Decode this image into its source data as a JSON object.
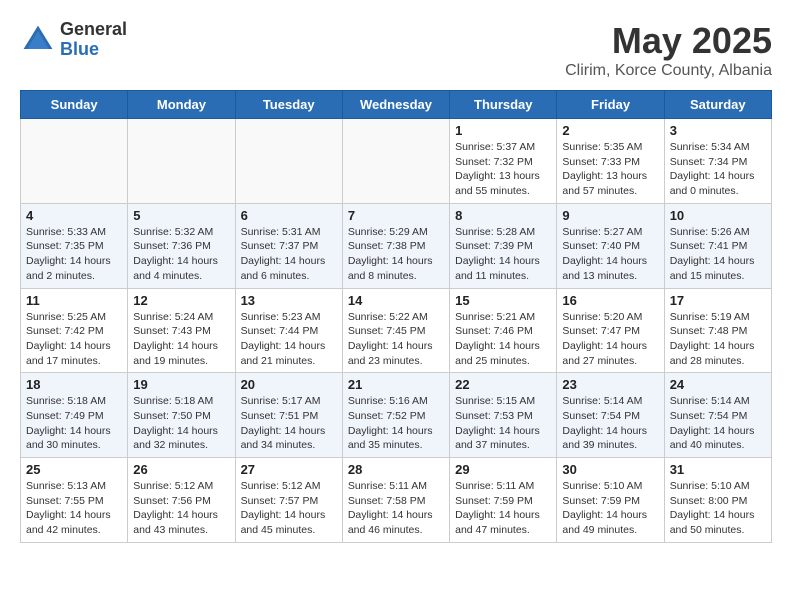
{
  "header": {
    "logo_general": "General",
    "logo_blue": "Blue",
    "month_title": "May 2025",
    "subtitle": "Clirim, Korce County, Albania"
  },
  "days_of_week": [
    "Sunday",
    "Monday",
    "Tuesday",
    "Wednesday",
    "Thursday",
    "Friday",
    "Saturday"
  ],
  "weeks": [
    {
      "stripe": false,
      "days": [
        {
          "num": "",
          "info": ""
        },
        {
          "num": "",
          "info": ""
        },
        {
          "num": "",
          "info": ""
        },
        {
          "num": "",
          "info": ""
        },
        {
          "num": "1",
          "info": "Sunrise: 5:37 AM\nSunset: 7:32 PM\nDaylight: 13 hours\nand 55 minutes."
        },
        {
          "num": "2",
          "info": "Sunrise: 5:35 AM\nSunset: 7:33 PM\nDaylight: 13 hours\nand 57 minutes."
        },
        {
          "num": "3",
          "info": "Sunrise: 5:34 AM\nSunset: 7:34 PM\nDaylight: 14 hours\nand 0 minutes."
        }
      ]
    },
    {
      "stripe": true,
      "days": [
        {
          "num": "4",
          "info": "Sunrise: 5:33 AM\nSunset: 7:35 PM\nDaylight: 14 hours\nand 2 minutes."
        },
        {
          "num": "5",
          "info": "Sunrise: 5:32 AM\nSunset: 7:36 PM\nDaylight: 14 hours\nand 4 minutes."
        },
        {
          "num": "6",
          "info": "Sunrise: 5:31 AM\nSunset: 7:37 PM\nDaylight: 14 hours\nand 6 minutes."
        },
        {
          "num": "7",
          "info": "Sunrise: 5:29 AM\nSunset: 7:38 PM\nDaylight: 14 hours\nand 8 minutes."
        },
        {
          "num": "8",
          "info": "Sunrise: 5:28 AM\nSunset: 7:39 PM\nDaylight: 14 hours\nand 11 minutes."
        },
        {
          "num": "9",
          "info": "Sunrise: 5:27 AM\nSunset: 7:40 PM\nDaylight: 14 hours\nand 13 minutes."
        },
        {
          "num": "10",
          "info": "Sunrise: 5:26 AM\nSunset: 7:41 PM\nDaylight: 14 hours\nand 15 minutes."
        }
      ]
    },
    {
      "stripe": false,
      "days": [
        {
          "num": "11",
          "info": "Sunrise: 5:25 AM\nSunset: 7:42 PM\nDaylight: 14 hours\nand 17 minutes."
        },
        {
          "num": "12",
          "info": "Sunrise: 5:24 AM\nSunset: 7:43 PM\nDaylight: 14 hours\nand 19 minutes."
        },
        {
          "num": "13",
          "info": "Sunrise: 5:23 AM\nSunset: 7:44 PM\nDaylight: 14 hours\nand 21 minutes."
        },
        {
          "num": "14",
          "info": "Sunrise: 5:22 AM\nSunset: 7:45 PM\nDaylight: 14 hours\nand 23 minutes."
        },
        {
          "num": "15",
          "info": "Sunrise: 5:21 AM\nSunset: 7:46 PM\nDaylight: 14 hours\nand 25 minutes."
        },
        {
          "num": "16",
          "info": "Sunrise: 5:20 AM\nSunset: 7:47 PM\nDaylight: 14 hours\nand 27 minutes."
        },
        {
          "num": "17",
          "info": "Sunrise: 5:19 AM\nSunset: 7:48 PM\nDaylight: 14 hours\nand 28 minutes."
        }
      ]
    },
    {
      "stripe": true,
      "days": [
        {
          "num": "18",
          "info": "Sunrise: 5:18 AM\nSunset: 7:49 PM\nDaylight: 14 hours\nand 30 minutes."
        },
        {
          "num": "19",
          "info": "Sunrise: 5:18 AM\nSunset: 7:50 PM\nDaylight: 14 hours\nand 32 minutes."
        },
        {
          "num": "20",
          "info": "Sunrise: 5:17 AM\nSunset: 7:51 PM\nDaylight: 14 hours\nand 34 minutes."
        },
        {
          "num": "21",
          "info": "Sunrise: 5:16 AM\nSunset: 7:52 PM\nDaylight: 14 hours\nand 35 minutes."
        },
        {
          "num": "22",
          "info": "Sunrise: 5:15 AM\nSunset: 7:53 PM\nDaylight: 14 hours\nand 37 minutes."
        },
        {
          "num": "23",
          "info": "Sunrise: 5:14 AM\nSunset: 7:54 PM\nDaylight: 14 hours\nand 39 minutes."
        },
        {
          "num": "24",
          "info": "Sunrise: 5:14 AM\nSunset: 7:54 PM\nDaylight: 14 hours\nand 40 minutes."
        }
      ]
    },
    {
      "stripe": false,
      "days": [
        {
          "num": "25",
          "info": "Sunrise: 5:13 AM\nSunset: 7:55 PM\nDaylight: 14 hours\nand 42 minutes."
        },
        {
          "num": "26",
          "info": "Sunrise: 5:12 AM\nSunset: 7:56 PM\nDaylight: 14 hours\nand 43 minutes."
        },
        {
          "num": "27",
          "info": "Sunrise: 5:12 AM\nSunset: 7:57 PM\nDaylight: 14 hours\nand 45 minutes."
        },
        {
          "num": "28",
          "info": "Sunrise: 5:11 AM\nSunset: 7:58 PM\nDaylight: 14 hours\nand 46 minutes."
        },
        {
          "num": "29",
          "info": "Sunrise: 5:11 AM\nSunset: 7:59 PM\nDaylight: 14 hours\nand 47 minutes."
        },
        {
          "num": "30",
          "info": "Sunrise: 5:10 AM\nSunset: 7:59 PM\nDaylight: 14 hours\nand 49 minutes."
        },
        {
          "num": "31",
          "info": "Sunrise: 5:10 AM\nSunset: 8:00 PM\nDaylight: 14 hours\nand 50 minutes."
        }
      ]
    }
  ]
}
